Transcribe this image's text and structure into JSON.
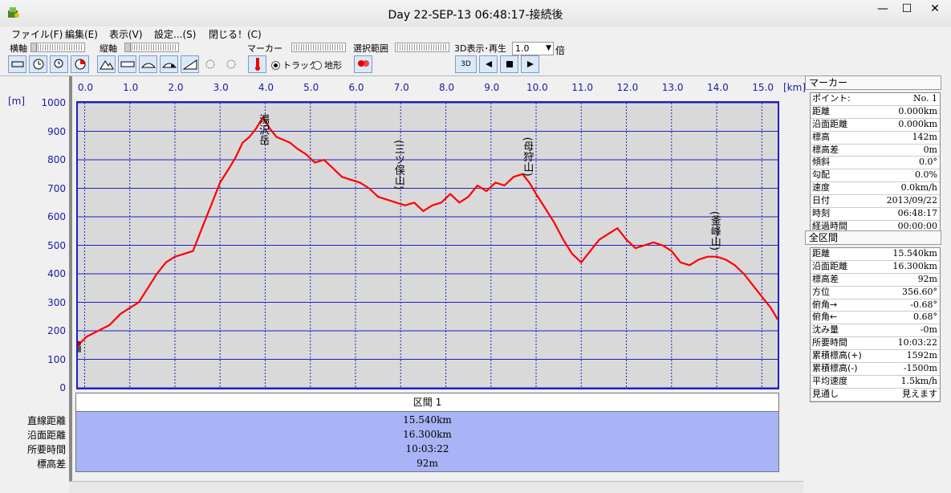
{
  "window": {
    "title": "Day 22-SEP-13 06:48:17-接続後",
    "minimize": "—",
    "maximize": "☐",
    "close": "✕"
  },
  "menu": [
    "ファイル(F)",
    "編集(E)",
    "表示(V)",
    "設定...(S)",
    "閉じる！(C)"
  ],
  "toolbar": {
    "horizontal_axis_label": "横軸",
    "vertical_axis_label": "縦軸",
    "marker_label": "マーカー",
    "selection_label": "選択範囲",
    "display3d_label": "3D表示･再生",
    "speed_value": "1.0",
    "speed_unit": "倍",
    "radio_track": "トラック",
    "radio_terrain": "地形",
    "play3d_text": "3D"
  },
  "chart_data": {
    "type": "line",
    "xlabel_unit": "[km]",
    "ylabel_unit": "[m]",
    "x_ticks": [
      "0.0",
      "1.0",
      "2.0",
      "3.0",
      "4.0",
      "5.0",
      "6.0",
      "7.0",
      "8.0",
      "9.0",
      "10.0",
      "11.0",
      "12.0",
      "13.0",
      "14.0",
      "15.0"
    ],
    "y_ticks": [
      "1000",
      "900",
      "800",
      "700",
      "600",
      "500",
      "400",
      "300",
      "200",
      "100",
      "0"
    ],
    "xlim": [
      -0.15,
      15.35
    ],
    "ylim": [
      0,
      1000
    ],
    "grid": true,
    "series": [
      {
        "color": "#ff0000",
        "x": [
          -0.15,
          0.05,
          0.3,
          0.55,
          0.8,
          1.0,
          1.2,
          1.4,
          1.6,
          1.8,
          2.0,
          2.2,
          2.4,
          2.6,
          2.8,
          3.0,
          3.2,
          3.35,
          3.5,
          3.65,
          3.8,
          3.95,
          4.1,
          4.25,
          4.4,
          4.55,
          4.7,
          4.9,
          5.1,
          5.3,
          5.5,
          5.7,
          5.9,
          6.1,
          6.3,
          6.5,
          6.7,
          6.9,
          7.1,
          7.3,
          7.5,
          7.7,
          7.9,
          8.1,
          8.3,
          8.5,
          8.7,
          8.9,
          9.1,
          9.3,
          9.5,
          9.7,
          9.85,
          10.0,
          10.2,
          10.4,
          10.6,
          10.8,
          11.0,
          11.2,
          11.4,
          11.6,
          11.8,
          12.0,
          12.2,
          12.4,
          12.6,
          12.8,
          13.0,
          13.2,
          13.4,
          13.6,
          13.8,
          14.0,
          14.2,
          14.4,
          14.6,
          14.8,
          15.0,
          15.2,
          15.35
        ],
        "y": [
          150,
          180,
          200,
          220,
          260,
          280,
          300,
          350,
          400,
          440,
          460,
          470,
          480,
          560,
          640,
          720,
          770,
          810,
          860,
          880,
          910,
          950,
          910,
          880,
          870,
          860,
          840,
          820,
          790,
          800,
          770,
          740,
          730,
          720,
          700,
          670,
          660,
          650,
          640,
          650,
          620,
          640,
          650,
          680,
          650,
          670,
          710,
          690,
          720,
          710,
          740,
          750,
          720,
          680,
          630,
          580,
          520,
          470,
          440,
          480,
          520,
          540,
          560,
          520,
          490,
          500,
          510,
          500,
          480,
          440,
          430,
          450,
          460,
          460,
          450,
          430,
          400,
          360,
          320,
          280,
          240
        ]
      }
    ],
    "annotations": [
      {
        "text": "湯沢岳",
        "x": 3.95,
        "y": 960
      },
      {
        "text": "(三ツ俣山)",
        "x": 6.95,
        "y": 870
      },
      {
        "text": "(母狩山)",
        "x": 9.8,
        "y": 880
      },
      {
        "text": "(釜峰山)",
        "x": 13.95,
        "y": 620
      }
    ],
    "start_marker": {
      "x": -0.15,
      "y": 150,
      "label": "👤"
    }
  },
  "interval": {
    "header": "区間 1",
    "labels": [
      "直線距離",
      "沿面距離",
      "所要時間",
      "標高差"
    ],
    "values": [
      "15.540km",
      "16.300km",
      "10:03:22",
      "92m"
    ]
  },
  "marker_panel": {
    "title": "マーカー",
    "rows": [
      {
        "k": "ポイント:",
        "v": "No. 1"
      },
      {
        "k": "距離",
        "v": "0.000km"
      },
      {
        "k": "沿面距離",
        "v": "0.000km"
      },
      {
        "k": "標高",
        "v": "142m"
      },
      {
        "k": "標高差",
        "v": "0m"
      },
      {
        "k": "傾斜",
        "v": "0.0°"
      },
      {
        "k": "勾配",
        "v": "0.0%"
      },
      {
        "k": "速度",
        "v": "0.0km/h"
      },
      {
        "k": "日付",
        "v": "2013/09/22"
      },
      {
        "k": "時刻",
        "v": "06:48:17"
      },
      {
        "k": "経過時間",
        "v": "00:00:00"
      }
    ]
  },
  "whole_panel": {
    "title": "全区間",
    "rows": [
      {
        "k": "距離",
        "v": "15.540km"
      },
      {
        "k": "沿面距離",
        "v": "16.300km"
      },
      {
        "k": "標高差",
        "v": "92m"
      },
      {
        "k": "方位",
        "v": "356.60°"
      },
      {
        "k": "俯角→",
        "v": "-0.68°"
      },
      {
        "k": "俯角←",
        "v": "0.68°"
      },
      {
        "k": "沈み量",
        "v": "-0m"
      },
      {
        "k": "所要時間",
        "v": "10:03:22"
      },
      {
        "k": "累積標高(+)",
        "v": "1592m"
      },
      {
        "k": "累積標高(-)",
        "v": "-1500m"
      },
      {
        "k": "平均速度",
        "v": "1.5km/h"
      },
      {
        "k": "見通し",
        "v": "見えます"
      }
    ]
  }
}
